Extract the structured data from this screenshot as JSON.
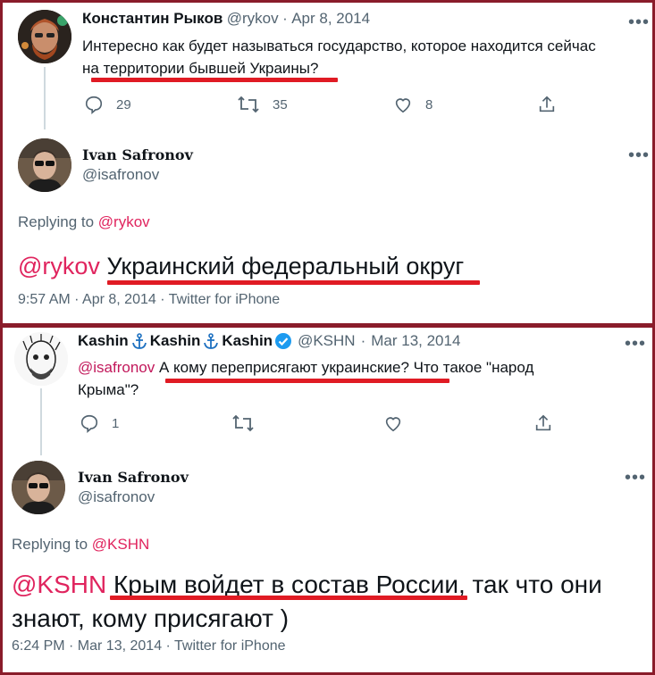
{
  "tweet1": {
    "author": "Константин Рыков",
    "handle": "@rykov",
    "date": "Apr 8, 2014",
    "text_line1": "Интересно как будет называться государство, которое находится сейчас",
    "text_line2": "на территории бывшей Украины?",
    "replies": "29",
    "retweets": "35",
    "likes": "8"
  },
  "reply1": {
    "author": "Ivan Safronov",
    "handle": "@isafronov",
    "replying_prefix": "Replying to",
    "replying_to": "@rykov",
    "mention": "@rykov",
    "text": "Украинский федеральный округ",
    "time": "9:57 AM · Apr 8, 2014 · Twitter for iPhone"
  },
  "tweet2": {
    "author_part": "Kashin",
    "handle": "@KSHN",
    "date": "Mar 13, 2014",
    "mention": "@isafronov",
    "text_line1": "А кому переприсягают украинские? Что такое \"народ",
    "text_line2": "Крыма\"?",
    "replies": "1"
  },
  "reply2": {
    "author": "Ivan Safronov",
    "handle": "@isafronov",
    "replying_prefix": "Replying to",
    "replying_to": "@KSHN",
    "mention": "@KSHN",
    "text_line1": "Крым войдет в состав России, так что они",
    "text_line2": "знают, кому присягают )",
    "time": "6:24 PM · Mar 13, 2014 · Twitter for iPhone"
  },
  "colors": {
    "frame": "#8a1c2a",
    "mention": "#e0245e",
    "underline": "#e01b24",
    "secondary_text": "#536471"
  }
}
